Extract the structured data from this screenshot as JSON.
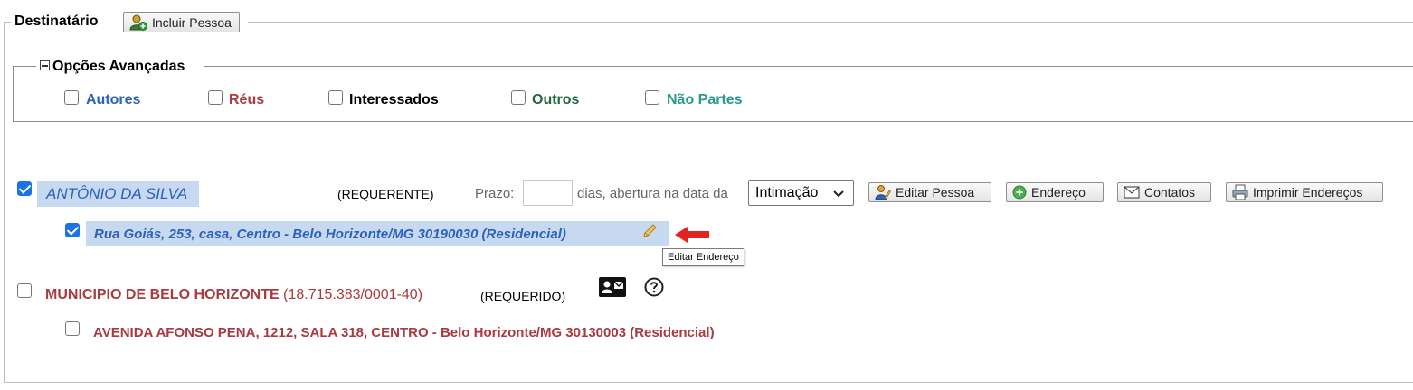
{
  "destinatario": {
    "legend": "Destinatário",
    "include_button": "Incluir Pessoa"
  },
  "advanced": {
    "legend": "Opções Avançadas",
    "options": [
      {
        "label": "Autores",
        "color": "#2e62b8",
        "checked": false
      },
      {
        "label": "Réus",
        "color": "#a93a3f",
        "checked": false
      },
      {
        "label": "Interessados",
        "color": "#000000",
        "checked": false
      },
      {
        "label": "Outros",
        "color": "#1f6b3a",
        "checked": false
      },
      {
        "label": "Não Partes",
        "color": "#2a9a8c",
        "checked": false
      }
    ]
  },
  "person1": {
    "name": "ANTÔNIO DA SILVA",
    "role": "(REQUERENTE)",
    "prazo_label": "Prazo:",
    "prazo_value": "",
    "dias_label": "dias, abertura na data da",
    "select_value": "Intimação",
    "buttons": {
      "edit_person": "Editar Pessoa",
      "address": "Endereço",
      "contacts": "Contatos",
      "print_addresses": "Imprimir Endereços"
    },
    "address": "Rua Goiás, 253, casa, Centro - Belo Horizonte/MG 30190030 (Residencial)",
    "tooltip": "Editar Endereço",
    "checked": true,
    "address_checked": true,
    "color": "#2e62b8"
  },
  "person2": {
    "name": "MUNICIPIO DE BELO HORIZONTE",
    "doc": "(18.715.383/0001-40)",
    "role": "(REQUERIDO)",
    "address": "AVENIDA AFONSO PENA, 1212, SALA 318, CENTRO - Belo Horizonte/MG 30130003 (Residencial)",
    "checked": false,
    "address_checked": false,
    "color": "#a93a3f"
  },
  "icons": {
    "include": "add-person-icon",
    "edit_person": "edit-person-icon",
    "address": "add-circle-icon",
    "contacts": "envelope-icon",
    "print": "printer-icon",
    "edit_address": "pencil-icon",
    "arrow": "red-arrow-icon",
    "contact_card": "contact-card-icon",
    "help": "help-icon",
    "collapse": "minus-box-icon"
  }
}
